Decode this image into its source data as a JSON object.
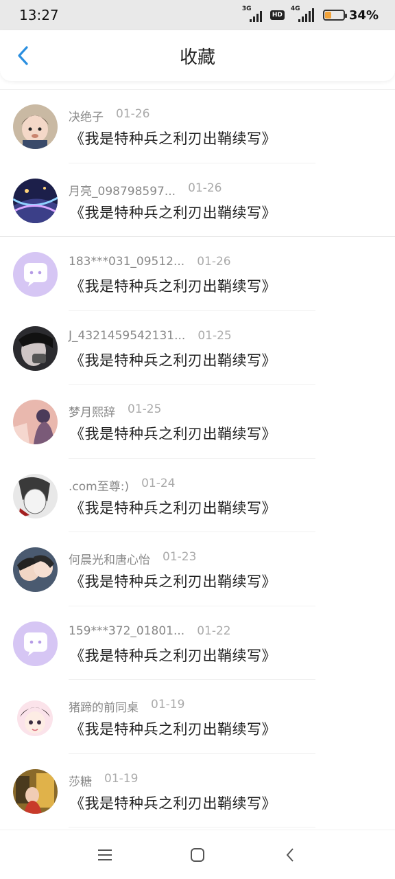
{
  "status_bar": {
    "time": "13:27",
    "network1": "3G",
    "hd": "HD",
    "network2": "4G",
    "battery": "34%",
    "battery_level": 0.34
  },
  "header": {
    "title": "收藏",
    "back_icon": "chevron-left-icon"
  },
  "favorites": [
    {
      "user": "决绝子",
      "date": "01-26",
      "book": "《我是特种兵之利刃出鞘续写》"
    },
    {
      "user": "月亮_098798597...",
      "date": "01-26",
      "book": "《我是特种兵之利刃出鞘续写》"
    },
    {
      "user": "183***031_09512...",
      "date": "01-26",
      "book": "《我是特种兵之利刃出鞘续写》"
    },
    {
      "user": "J_4321459542131...",
      "date": "01-25",
      "book": "《我是特种兵之利刃出鞘续写》"
    },
    {
      "user": "梦月熙辞",
      "date": "01-25",
      "book": "《我是特种兵之利刃出鞘续写》"
    },
    {
      "user": ".com至尊:)",
      "date": "01-24",
      "book": "《我是特种兵之利刃出鞘续写》"
    },
    {
      "user": "何晨光和唐心怡",
      "date": "01-23",
      "book": "《我是特种兵之利刃出鞘续写》"
    },
    {
      "user": "159***372_01801...",
      "date": "01-22",
      "book": "《我是特种兵之利刃出鞘续写》"
    },
    {
      "user": "猪蹄的前同桌",
      "date": "01-19",
      "book": "《我是特种兵之利刃出鞘续写》"
    },
    {
      "user": "莎糖",
      "date": "01-19",
      "book": "《我是特种兵之利刃出鞘续写》"
    }
  ],
  "nav_bar": {
    "menu_icon": "menu-icon",
    "home_icon": "home-icon",
    "back_icon": "back-icon"
  },
  "colors": {
    "accent": "#2a8fe0",
    "default_avatar": "#d6c6f4",
    "battery": "#f2a33a"
  }
}
